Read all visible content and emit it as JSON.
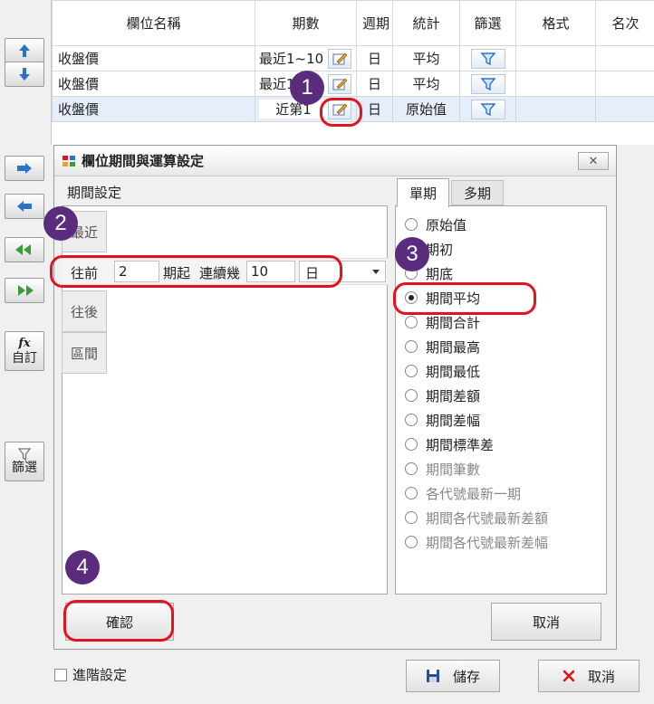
{
  "grid": {
    "headers": [
      "欄位名稱",
      "期數",
      "週期",
      "統計",
      "篩選",
      "格式",
      "名次"
    ],
    "rows": [
      {
        "name": "收盤價",
        "period": "最近1~10",
        "cycle": "日",
        "stat": "平均"
      },
      {
        "name": "收盤價",
        "period": "最近1~1",
        "cycle": "日",
        "stat": "平均"
      },
      {
        "name": "收盤價",
        "period": "近第1",
        "cycle": "日",
        "stat": "原始值"
      }
    ]
  },
  "left_toolbar": {
    "custom_label": "自訂",
    "custom_fx": "fx",
    "filter_label": "篩選"
  },
  "dialog": {
    "title": "欄位期間與運算設定",
    "close_glyph": "✕",
    "period_settings_label": "期間設定",
    "period_tabs": [
      "最近",
      "往後",
      "區間"
    ],
    "row": {
      "direction": "往前",
      "start_value": "2",
      "start_label": "期起",
      "consecutive_label": "連續幾",
      "count_value": "10",
      "unit": "日"
    },
    "calc_tabs": [
      "單期",
      "多期"
    ],
    "options": [
      {
        "label": "原始值",
        "enabled": true
      },
      {
        "label": "期初",
        "enabled": true
      },
      {
        "label": "期底",
        "enabled": true
      },
      {
        "label": "期間平均",
        "enabled": true
      },
      {
        "label": "期間合計",
        "enabled": true
      },
      {
        "label": "期間最高",
        "enabled": true
      },
      {
        "label": "期間最低",
        "enabled": true
      },
      {
        "label": "期間差額",
        "enabled": true
      },
      {
        "label": "期間差幅",
        "enabled": true
      },
      {
        "label": "期間標準差",
        "enabled": true
      },
      {
        "label": "期間筆數",
        "enabled": false
      },
      {
        "label": "各代號最新一期",
        "enabled": false
      },
      {
        "label": "期間各代號最新差額",
        "enabled": false
      },
      {
        "label": "期間各代號最新差幅",
        "enabled": false
      }
    ],
    "selected_option": "期間平均",
    "confirm_label": "確認",
    "cancel_label": "取消"
  },
  "footer": {
    "advanced_label": "進階設定",
    "save_label": "儲存",
    "cancel_label": "取消"
  },
  "annotations": [
    "1",
    "2",
    "3",
    "4"
  ],
  "colors": {
    "highlight": "#e0141e",
    "badge": "#5b2c7e",
    "accent": "#2a73c8"
  }
}
